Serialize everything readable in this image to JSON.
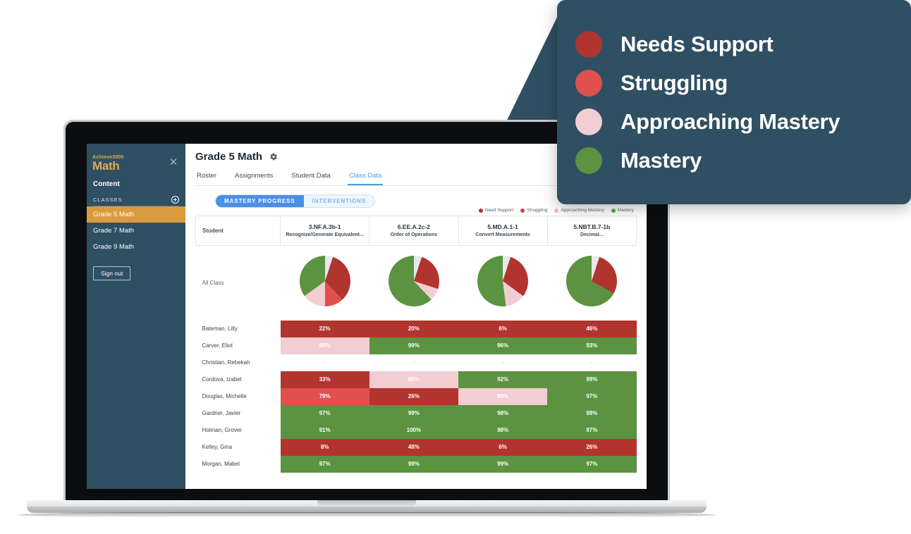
{
  "callout": {
    "items": [
      {
        "label": "Needs Support",
        "color": "#b2342f",
        "icon": "legend-dot-icon"
      },
      {
        "label": "Struggling",
        "color": "#e0504d",
        "icon": "legend-dot-icon"
      },
      {
        "label": "Approaching Mastery",
        "color": "#f2cdd2",
        "icon": "legend-dot-icon"
      },
      {
        "label": "Mastery",
        "color": "#5b9341",
        "icon": "legend-dot-icon"
      }
    ]
  },
  "sidebar": {
    "logo_top": "Achieve3000",
    "logo_main": "Math",
    "close_icon": "close-icon",
    "content_label": "Content",
    "classes_header": "CLASSES",
    "add_class_icon": "plus-circle-icon",
    "classes": [
      {
        "label": "Grade 5 Math",
        "active": true
      },
      {
        "label": "Grade 7 Math",
        "active": false
      },
      {
        "label": "Grade 9 Math",
        "active": false
      }
    ],
    "signout_label": "Sign out"
  },
  "header": {
    "title": "Grade 5 Math",
    "settings_icon": "gear-icon",
    "tabs": [
      {
        "label": "Roster",
        "active": false
      },
      {
        "label": "Assignments",
        "active": false
      },
      {
        "label": "Student Data",
        "active": false
      },
      {
        "label": "Class Data",
        "active": true
      }
    ],
    "segmented": [
      {
        "label": "MASTERY PROGRESS",
        "active": true
      },
      {
        "label": "INTERVENTIONS",
        "active": false
      }
    ]
  },
  "inline_legend": [
    {
      "label": "Need Support",
      "color": "#b2342f"
    },
    {
      "label": "Struggling",
      "color": "#cf4440"
    },
    {
      "label": "Approaching Mastery",
      "color": "#ddb8bd"
    },
    {
      "label": "Mastery",
      "color": "#5b9341"
    }
  ],
  "colors": {
    "needs_support": "#b2342f",
    "struggling": "#e0504d",
    "approaching": "#f2cdd2",
    "mastery": "#5b9341",
    "no_data": "#e6e8e9",
    "accent_blue": "#4a8fe6",
    "sidebar_bg": "#2f4f63",
    "sidebar_active": "#d99b3e",
    "logo_gold": "#e4a951"
  },
  "table": {
    "student_header": "Student",
    "all_class_label": "All Class",
    "columns": [
      {
        "code": "3.NF.A.3b-1",
        "name": "Recognize/Generate Equivalent..."
      },
      {
        "code": "6.EE.A.2c-2",
        "name": "Order of Operations"
      },
      {
        "code": "5.MD.A.1-1",
        "name": "Convert Measurements"
      },
      {
        "code": "5.NBT.B.7-1b",
        "name": "Decimal..."
      }
    ],
    "rows": [
      {
        "student": "Bateman, Lilly",
        "cells": [
          {
            "value": "22%",
            "level": "needs_support"
          },
          {
            "value": "20%",
            "level": "needs_support"
          },
          {
            "value": "6%",
            "level": "needs_support"
          },
          {
            "value": "46%",
            "level": "needs_support"
          }
        ]
      },
      {
        "student": "Carver, Eliot",
        "cells": [
          {
            "value": "80%",
            "level": "approaching"
          },
          {
            "value": "99%",
            "level": "mastery"
          },
          {
            "value": "96%",
            "level": "mastery"
          },
          {
            "value": "93%",
            "level": "mastery"
          }
        ]
      },
      {
        "student": "Christian, Rebekah",
        "cells": [
          {
            "value": "-",
            "level": "none"
          },
          {
            "value": "-",
            "level": "none"
          },
          {
            "value": "-",
            "level": "none"
          },
          {
            "value": "-",
            "level": "none"
          }
        ]
      },
      {
        "student": "Cordova, Izabel",
        "cells": [
          {
            "value": "33%",
            "level": "needs_support"
          },
          {
            "value": "85%",
            "level": "approaching"
          },
          {
            "value": "92%",
            "level": "mastery"
          },
          {
            "value": "99%",
            "level": "mastery"
          }
        ]
      },
      {
        "student": "Douglas, Michelle",
        "cells": [
          {
            "value": "79%",
            "level": "struggling"
          },
          {
            "value": "26%",
            "level": "needs_support"
          },
          {
            "value": "80%",
            "level": "approaching"
          },
          {
            "value": "97%",
            "level": "mastery"
          }
        ]
      },
      {
        "student": "Gardner, Javier",
        "cells": [
          {
            "value": "97%",
            "level": "mastery"
          },
          {
            "value": "99%",
            "level": "mastery"
          },
          {
            "value": "98%",
            "level": "mastery"
          },
          {
            "value": "99%",
            "level": "mastery"
          }
        ]
      },
      {
        "student": "Holman, Grover",
        "cells": [
          {
            "value": "91%",
            "level": "mastery"
          },
          {
            "value": "100%",
            "level": "mastery"
          },
          {
            "value": "98%",
            "level": "mastery"
          },
          {
            "value": "97%",
            "level": "mastery"
          }
        ]
      },
      {
        "student": "Kelley, Gina",
        "cells": [
          {
            "value": "8%",
            "level": "needs_support"
          },
          {
            "value": "48%",
            "level": "needs_support"
          },
          {
            "value": "6%",
            "level": "needs_support"
          },
          {
            "value": "26%",
            "level": "needs_support"
          }
        ]
      },
      {
        "student": "Morgan, Mabel",
        "cells": [
          {
            "value": "97%",
            "level": "mastery"
          },
          {
            "value": "99%",
            "level": "mastery"
          },
          {
            "value": "99%",
            "level": "mastery"
          },
          {
            "value": "97%",
            "level": "mastery"
          }
        ]
      }
    ]
  },
  "chart_data": [
    {
      "type": "pie",
      "title": "3.NF.A.3b-1 Recognize/Generate Equivalent...",
      "labels": [
        "No Data",
        "Needs Support",
        "Struggling",
        "Approaching Mastery",
        "Mastery"
      ],
      "values": [
        5,
        33,
        12,
        15,
        35
      ],
      "colors": [
        "#e6e8e9",
        "#b2342f",
        "#e0504d",
        "#f2cdd2",
        "#5b9341"
      ],
      "legend": "top-right"
    },
    {
      "type": "pie",
      "title": "6.EE.A.2c-2 Order of Operations",
      "labels": [
        "No Data",
        "Needs Support",
        "Approaching Mastery",
        "Mastery"
      ],
      "values": [
        5,
        25,
        8,
        62
      ],
      "colors": [
        "#e6e8e9",
        "#b2342f",
        "#f2cdd2",
        "#5b9341"
      ],
      "legend": "top-right"
    },
    {
      "type": "pie",
      "title": "5.MD.A.1-1 Convert Measurements",
      "labels": [
        "No Data",
        "Needs Support",
        "Approaching Mastery",
        "Mastery"
      ],
      "values": [
        5,
        30,
        13,
        52
      ],
      "colors": [
        "#e6e8e9",
        "#b2342f",
        "#f2cdd2",
        "#5b9341"
      ],
      "legend": "top-right"
    },
    {
      "type": "pie",
      "title": "5.NBT.B.7-1b Decimal...",
      "labels": [
        "No Data",
        "Needs Support",
        "Mastery"
      ],
      "values": [
        5,
        28,
        67
      ],
      "colors": [
        "#e6e8e9",
        "#b2342f",
        "#5b9341"
      ],
      "legend": "top-right"
    }
  ]
}
